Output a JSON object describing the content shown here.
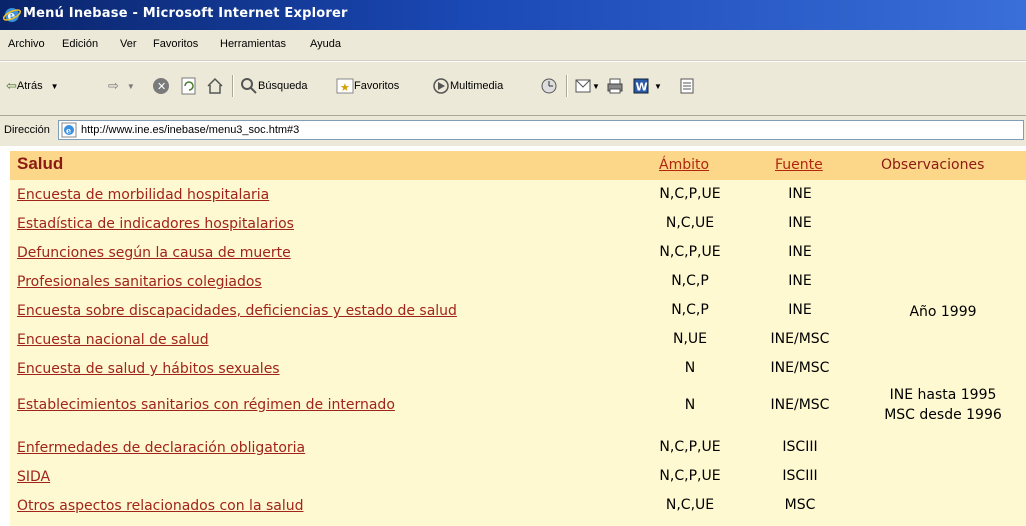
{
  "window": {
    "title": "Menú Inebase - Microsoft Internet Explorer"
  },
  "menubar": [
    "Archivo",
    "Edición",
    "Ver",
    "Favoritos",
    "Herramientas",
    "Ayuda"
  ],
  "toolbar": {
    "back_label": "Atrás",
    "search_label": "Búsqueda",
    "favorites_label": "Favoritos",
    "multimedia_label": "Multimedia"
  },
  "address": {
    "label": "Dirección",
    "url": "http://www.ine.es/inebase/menu3_soc.htm#3"
  },
  "table": {
    "title": "Salud",
    "col_ambito": "Ámbito",
    "col_fuente": "Fuente",
    "col_observaciones": "Observaciones",
    "rows": [
      {
        "name": "Encuesta de morbilidad hospitalaria",
        "ambito": "N,C,P,UE",
        "fuente": "INE",
        "obs": ""
      },
      {
        "name": "Estadística de indicadores hospitalarios",
        "ambito": "N,C,UE",
        "fuente": "INE",
        "obs": ""
      },
      {
        "name": "Defunciones según la causa de muerte",
        "ambito": "N,C,P,UE",
        "fuente": "INE",
        "obs": ""
      },
      {
        "name": "Profesionales sanitarios colegiados",
        "ambito": "N,C,P",
        "fuente": "INE",
        "obs": ""
      },
      {
        "name": "Encuesta sobre discapacidades, deficiencias y estado de salud",
        "ambito": "N,C,P",
        "fuente": "INE",
        "obs": "Año 1999"
      },
      {
        "name": "Encuesta nacional de salud",
        "ambito": "N,UE",
        "fuente": "INE/MSC",
        "obs": ""
      },
      {
        "name": "Encuesta de salud y hábitos sexuales",
        "ambito": "N",
        "fuente": "INE/MSC",
        "obs": ""
      },
      {
        "name": "Establecimientos sanitarios con régimen de internado",
        "ambito": "N",
        "fuente": "INE/MSC",
        "obs": "INE hasta 1995",
        "obs2": "MSC desde 1996"
      },
      {
        "name": "Enfermedades de declaración obligatoria",
        "ambito": "N,C,P,UE",
        "fuente": "ISCIII",
        "obs": ""
      },
      {
        "name": "SIDA",
        "ambito": "N,C,P,UE",
        "fuente": "ISCIII",
        "obs": ""
      },
      {
        "name": "Otros aspectos relacionados con la salud",
        "ambito": "N,C,UE",
        "fuente": "MSC",
        "obs": ""
      }
    ]
  }
}
